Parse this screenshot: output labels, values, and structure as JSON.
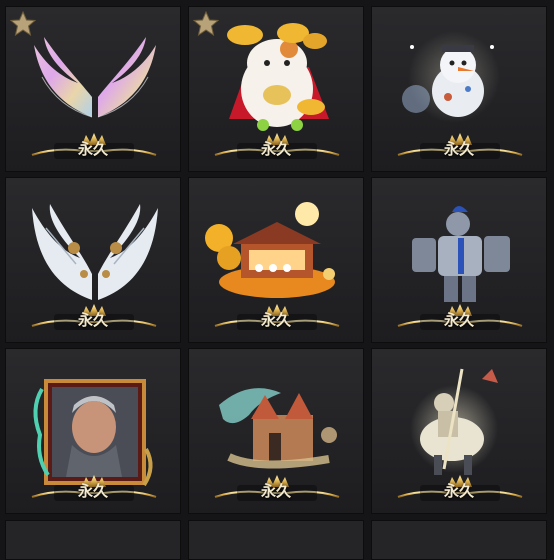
{
  "items": [
    {
      "name": "rainbow-angel-wings",
      "label": "永久",
      "starred": true
    },
    {
      "name": "lucky-cat-gold",
      "label": "永久",
      "starred": true
    },
    {
      "name": "snowman-ornament",
      "label": "永久",
      "starred": false
    },
    {
      "name": "mechanical-white-wings",
      "label": "永久",
      "starred": false
    },
    {
      "name": "moon-festival-house",
      "label": "永久",
      "starred": false
    },
    {
      "name": "silver-knight-armor",
      "label": "永久",
      "starred": false
    },
    {
      "name": "warrior-portrait-frame",
      "label": "永久",
      "starred": false
    },
    {
      "name": "dragon-castle",
      "label": "永久",
      "starred": false
    },
    {
      "name": "glowing-mounted-knight",
      "label": "永久",
      "starred": false
    }
  ],
  "colors": {
    "cell_bg": "#242427",
    "label_text": "#f3e9cf",
    "gold": "#d8b15a"
  }
}
